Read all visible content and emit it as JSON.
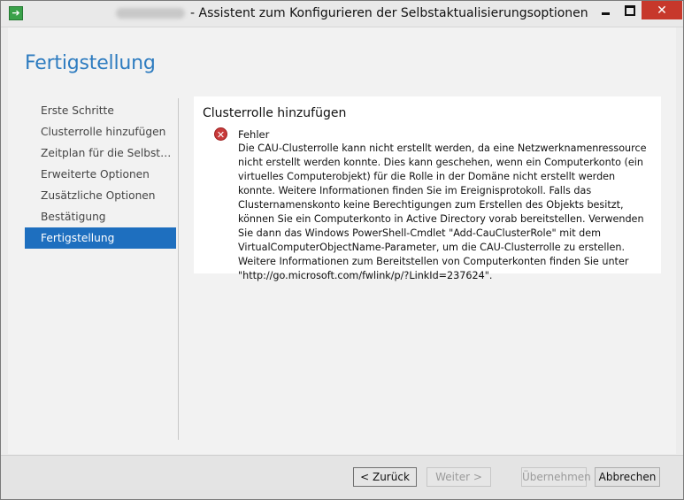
{
  "window": {
    "title": "- Assistent zum Konfigurieren der Selbstaktualisierungsoptionen",
    "close_label": "✕"
  },
  "page": {
    "title": "Fertigstellung"
  },
  "nav": {
    "items": [
      {
        "label": "Erste Schritte"
      },
      {
        "label": "Clusterrolle hinzufügen"
      },
      {
        "label": "Zeitplan für die Selbstaktualisierung"
      },
      {
        "label": "Erweiterte Optionen"
      },
      {
        "label": "Zusätzliche Optionen"
      },
      {
        "label": "Bestätigung"
      },
      {
        "label": "Fertigstellung"
      }
    ],
    "active_index": 6
  },
  "panel": {
    "section_title": "Clusterrolle hinzufügen",
    "error_label": "Fehler",
    "error_message": "Die CAU-Clusterrolle kann nicht erstellt werden, da eine Netzwerknamenressource nicht erstellt werden konnte. Dies kann geschehen, wenn ein Computerkonto (ein virtuelles Computerobjekt) für die Rolle in der Domäne nicht erstellt werden konnte. Weitere Informationen finden Sie im Ereignisprotokoll. Falls das Clusternamenskonto keine Berechtigungen zum Erstellen des Objekts besitzt, können Sie ein Computerkonto in Active Directory vorab bereitstellen. Verwenden Sie dann das Windows PowerShell-Cmdlet \"Add-CauClusterRole\" mit dem VirtualComputerObjectName-Parameter, um die CAU-Clusterrolle zu erstellen. Weitere Informationen zum Bereitstellen von Computerkonten finden Sie unter \"http://go.microsoft.com/fwlink/p/?LinkId=237624\"."
  },
  "footer": {
    "back_label": "< Zurück",
    "next_label": "Weiter >",
    "apply_label": "Übernehmen",
    "cancel_label": "Abbrechen"
  },
  "colors": {
    "accent": "#1e6fbf",
    "title_blue": "#2e7cc0",
    "close_red": "#c7382b",
    "error_red": "#c83a3a"
  }
}
